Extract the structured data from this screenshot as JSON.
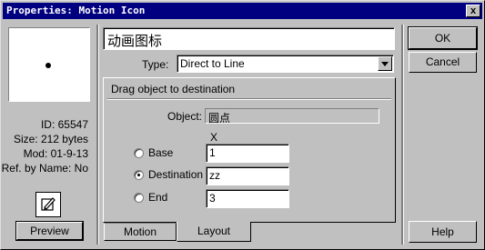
{
  "window": {
    "title": "Properties: Motion Icon",
    "close_glyph": "x"
  },
  "preview": {
    "id_text": "ID: 65547",
    "size_text": "Size: 212 bytes",
    "mod_text": "Mod: 01-9-13",
    "ref_text": "Ref. by Name: No",
    "button_label": "Preview",
    "edit_icon": "edit-icon"
  },
  "icon_name": "动画图标",
  "type": {
    "label": "Type:",
    "value": "Direct to Line"
  },
  "group": {
    "title": "Drag object to destination",
    "object_label": "Object:",
    "object_value": "圆点",
    "x_header": "X",
    "options": [
      {
        "label": "Base",
        "value": "1",
        "selected": false
      },
      {
        "label": "Destination",
        "value": "zz",
        "selected": true
      },
      {
        "label": "End",
        "value": "3",
        "selected": false
      }
    ]
  },
  "tabs": [
    {
      "label": "Motion",
      "active": false
    },
    {
      "label": "Layout",
      "active": true
    }
  ],
  "buttons": {
    "ok": "OK",
    "cancel": "Cancel",
    "help": "Help"
  }
}
